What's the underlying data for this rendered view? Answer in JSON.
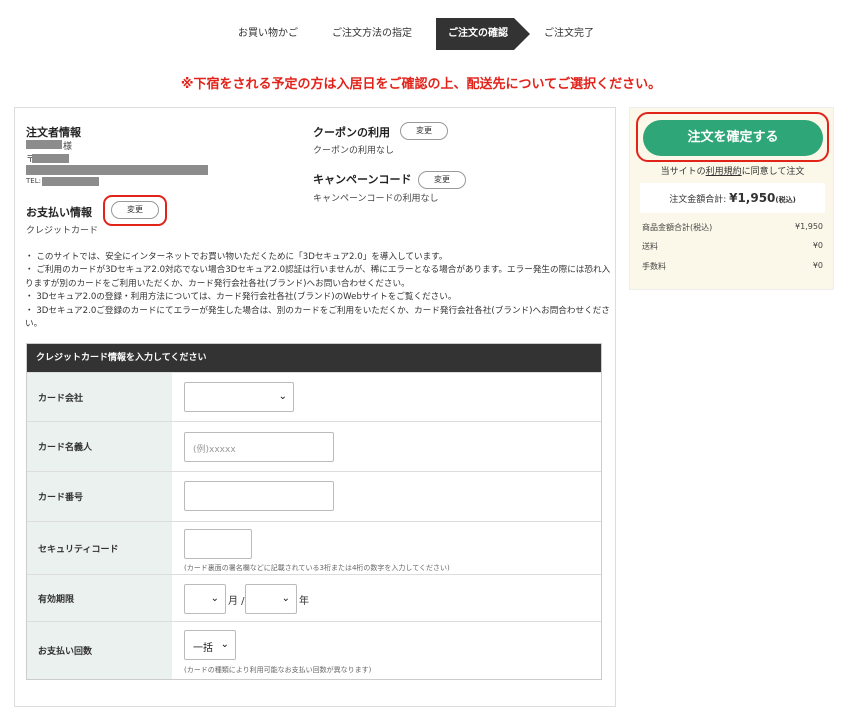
{
  "steps": [
    {
      "label": "お買い物かご"
    },
    {
      "label": "ご注文方法の指定"
    },
    {
      "label": "ご注文の確認"
    },
    {
      "label": "ご注文完了"
    }
  ],
  "notice": "※下宿をされる予定の方は入居日をご確認の上、配送先についてご選択ください。",
  "orderer": {
    "title": "注文者情報",
    "sama": "様",
    "postal_mark": "〒",
    "tel_label": "TEL:"
  },
  "payment": {
    "title": "お支払い情報",
    "change": "変更",
    "method": "クレジットカード"
  },
  "coupon": {
    "title": "クーポンの利用",
    "change": "変更",
    "status": "クーポンの利用なし"
  },
  "campaign": {
    "title": "キャンペーンコード",
    "change": "変更",
    "status": "キャンペーンコードの利用なし"
  },
  "notes": [
    "・ このサイトでは、安全にインターネットでお買い物いただくために「3Dセキュア2.0」を導入しています。",
    "・ ご利用のカードが3Dセキュア2.0対応でない場合3Dセキュア2.0認証は行いませんが、稀にエラーとなる場合があります。エラー発生の際には恐れ入りますが別のカードをご利用いただくか、カード発行会社各社(ブランド)へお問い合わせください。",
    "・ 3Dセキュア2.0の登録・利用方法については、カード発行会社各社(ブランド)のWebサイトをご覧ください。",
    "・ 3Dセキュア2.0ご登録のカードにてエラーが発生した場合は、別のカードをご利用をいただくか、カード発行会社各社(ブランド)へお問合わせください。"
  ],
  "card_form": {
    "header": "クレジットカード情報を入力してください",
    "company_label": "カード会社",
    "holder_label": "カード名義人",
    "holder_placeholder": "(例)xxxxx",
    "number_label": "カード番号",
    "security_label": "セキュリティコード",
    "security_hint": "(カード裏面の署名欄などに記載されている3桁または4桁の数字を入力してください)",
    "expiry_label": "有効期限",
    "month_unit": "月 /",
    "year_unit": "年",
    "installments_label": "お支払い回数",
    "installments_value": "一括",
    "installments_hint": "(カードの種類により利用可能なお支払い回数が異なります)",
    "arrow": "❯"
  },
  "summary": {
    "confirm_button": "注文を確定する",
    "agree_prefix": "当サイトの",
    "agree_link": "利用規約",
    "agree_suffix": "に同意して注文",
    "total_label": "注文金額合計: ",
    "total_value": "¥1,950",
    "total_tax": "(税込)",
    "lines": [
      {
        "label": "商品金額合計(税込)",
        "value": "¥1,950"
      },
      {
        "label": "送料",
        "value": "¥0"
      },
      {
        "label": "手数料",
        "value": "¥0"
      }
    ]
  },
  "colors": {
    "accent": "#2fa678",
    "alert": "#e2231a",
    "dark": "#333333"
  }
}
